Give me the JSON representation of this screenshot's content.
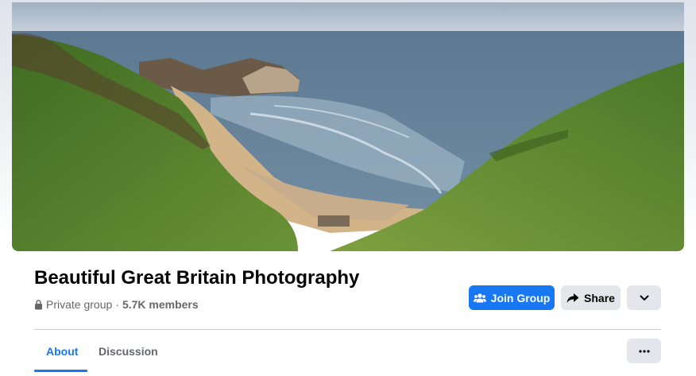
{
  "group": {
    "name": "Beautiful Great Britain Photography",
    "privacy": "Private group",
    "separator": "·",
    "members": "5.7K members",
    "cover_photo": "coastal-cove-landscape"
  },
  "actions": {
    "join_label": "Join Group",
    "share_label": "Share",
    "join_icon": "people-icon",
    "share_icon": "share-arrow-icon",
    "more_icon": "chevron-down-icon"
  },
  "tabs": [
    {
      "label": "About",
      "active": true
    },
    {
      "label": "Discussion",
      "active": false
    }
  ],
  "colors": {
    "accent": "#1877f2",
    "secondary_button": "#e4e6eb",
    "text_primary": "#050505",
    "text_secondary": "#65676b"
  }
}
